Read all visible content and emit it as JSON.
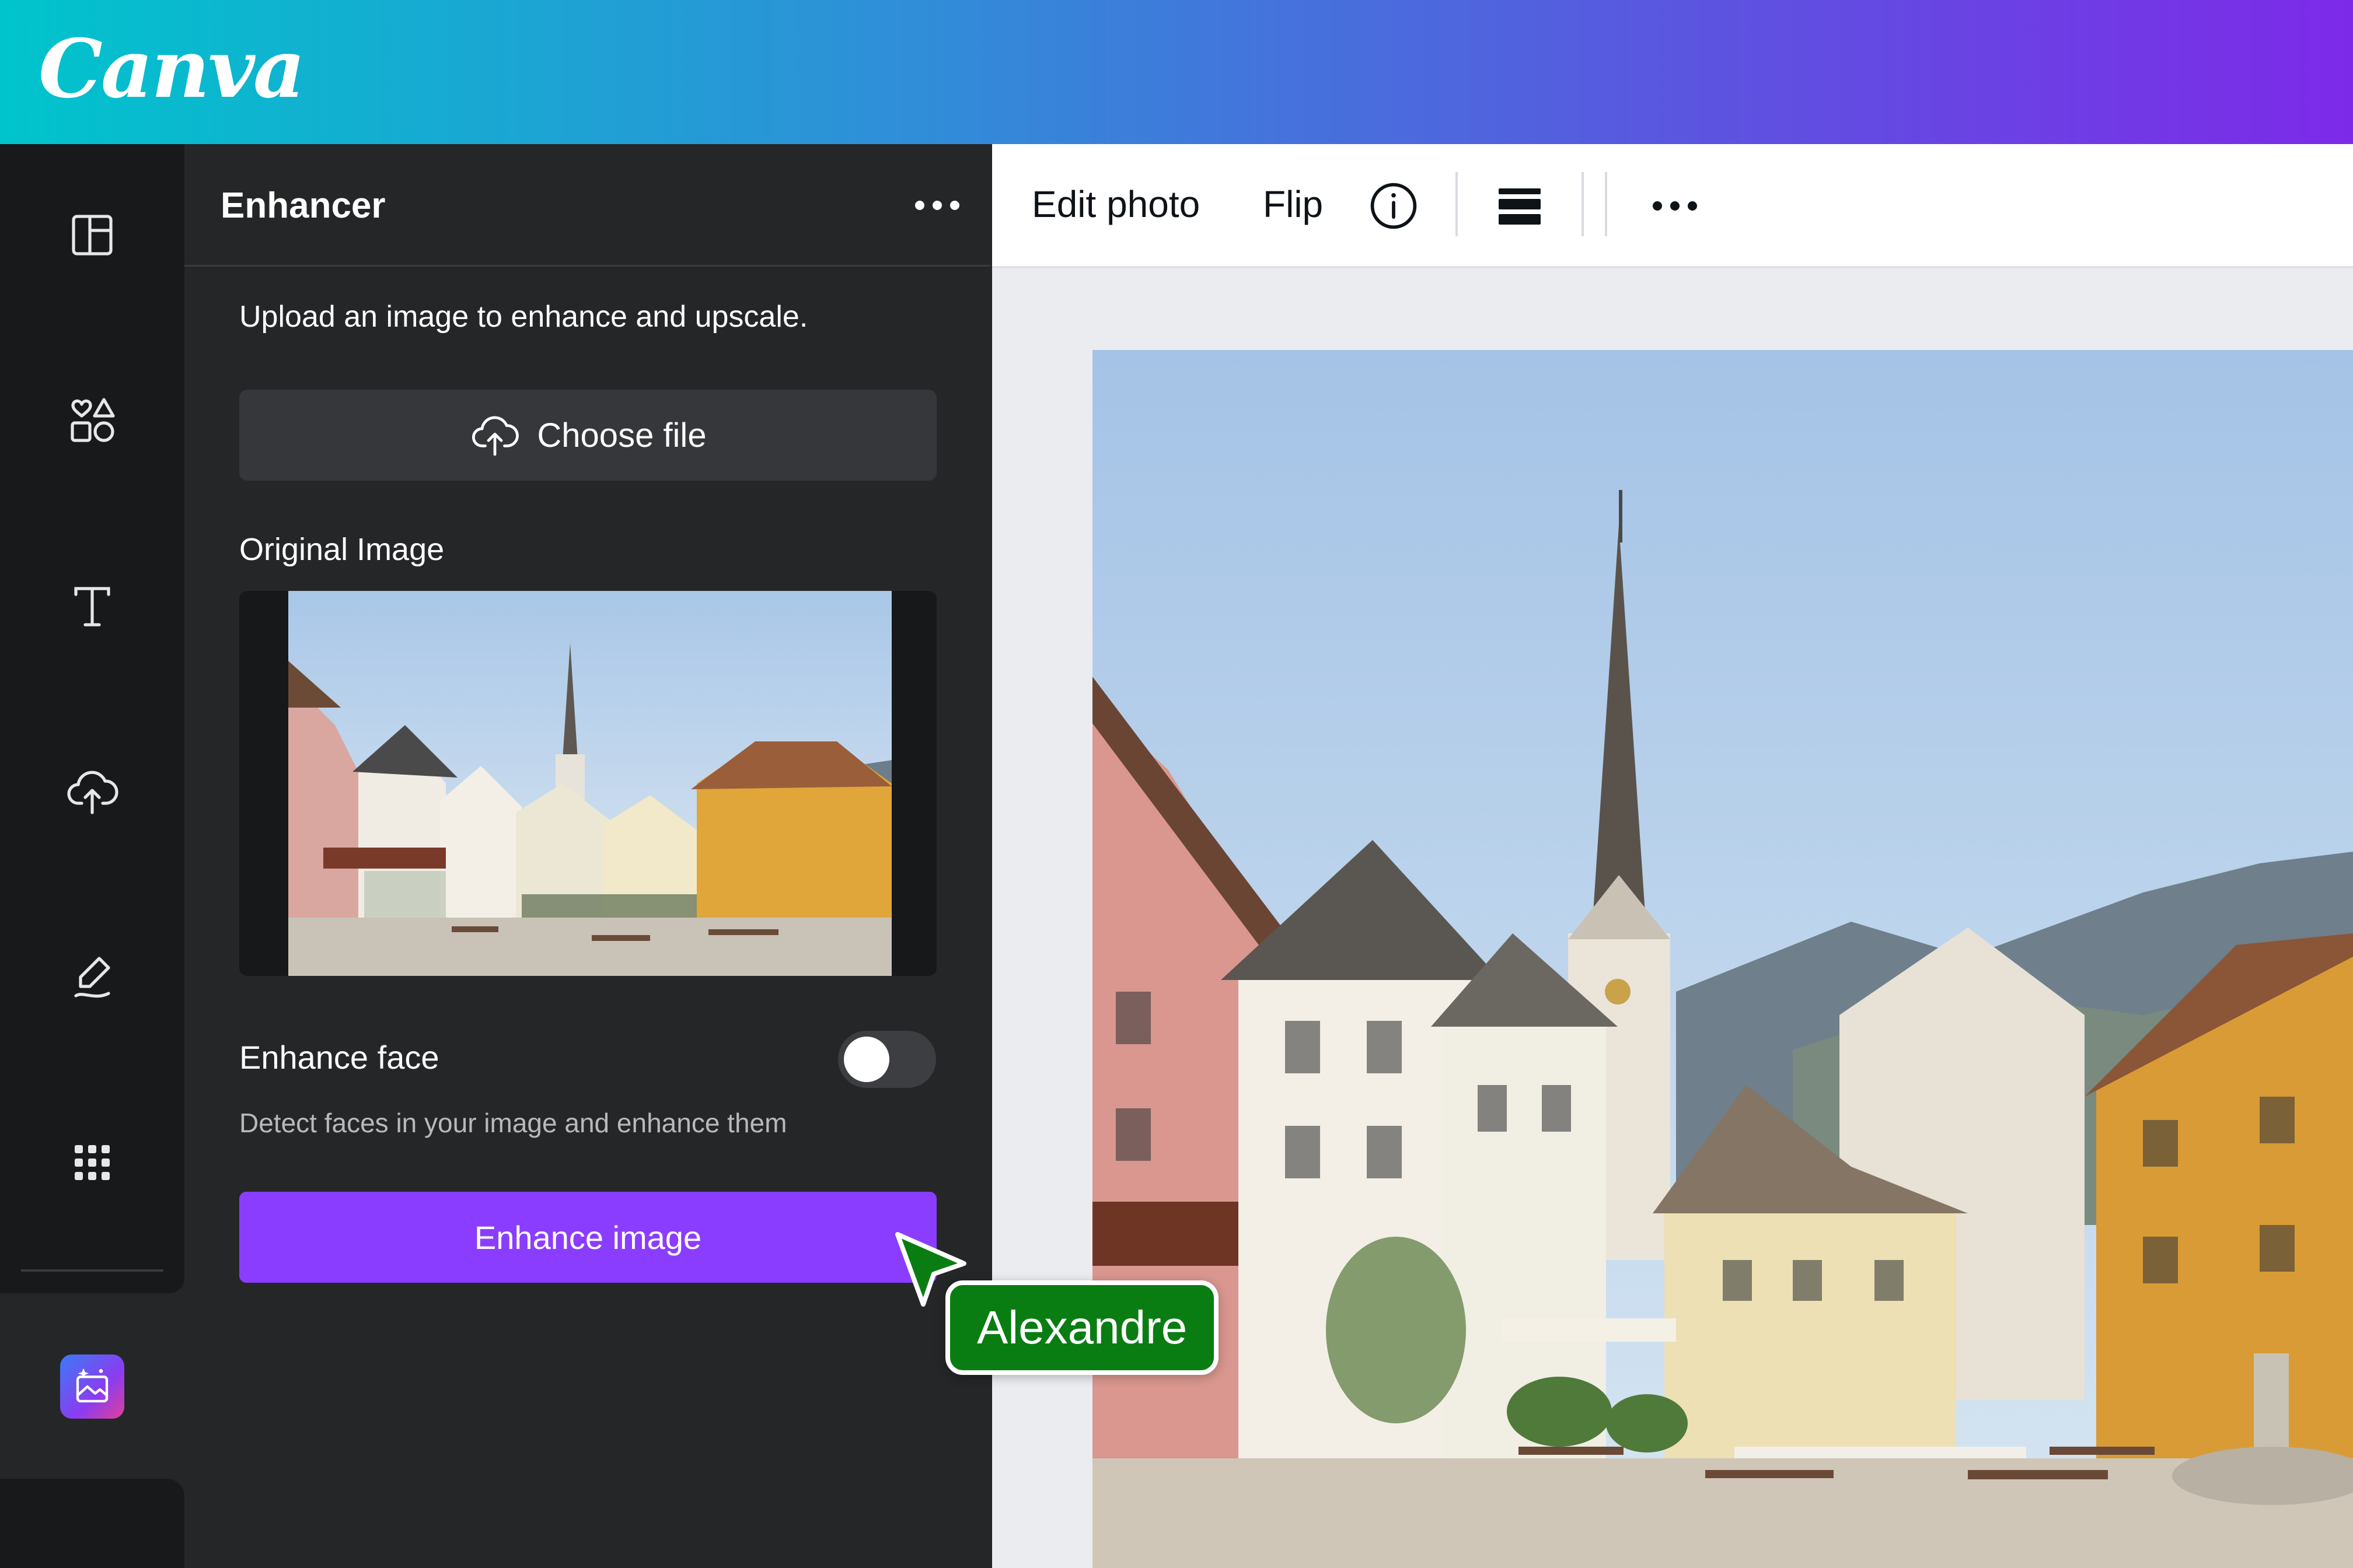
{
  "app": {
    "logo_text": "Canva"
  },
  "sidebar": {
    "icons": [
      "layout-icon",
      "elements-icon",
      "text-icon",
      "upload-icon",
      "draw-icon",
      "apps-grid-icon"
    ],
    "active_app_icon": "magic-image-icon"
  },
  "panel": {
    "title": "Enhancer",
    "description": "Upload an image to enhance and upscale.",
    "choose_file_label": "Choose file",
    "original_image_label": "Original Image",
    "enhance_face_label": "Enhance face",
    "enhance_face_enabled": false,
    "enhance_face_description": "Detect faces in your image and enhance them",
    "enhance_button_label": "Enhance image"
  },
  "toolbar": {
    "edit_photo_label": "Edit photo",
    "flip_label": "Flip"
  },
  "collaborator": {
    "name": "Alexandre",
    "color": "#0a7d12"
  },
  "colors": {
    "accent_purple": "#8b3dff",
    "panel_bg": "#252628",
    "rail_bg": "#18191b"
  }
}
